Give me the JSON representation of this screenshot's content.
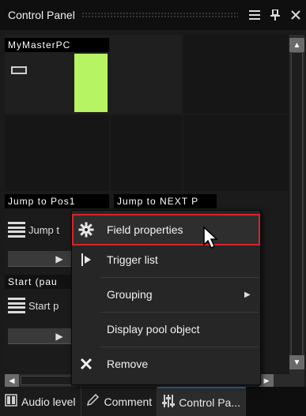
{
  "window": {
    "title": "Control Panel",
    "menu_icon": "hamburger-icon",
    "pin_icon": "pin-icon",
    "close_icon": "close-icon"
  },
  "grid": {
    "master_label": "MyMasterPC",
    "executors": [
      {
        "label": "Jump to Pos1",
        "row_text": "Jump t",
        "play_symbol": "▶"
      },
      {
        "label": "Jump to NEXT P"
      },
      {
        "label": "Start  (pau",
        "row_text": "Start p",
        "play_symbol": "▶"
      }
    ]
  },
  "context_menu": {
    "items": [
      {
        "label": "Field properties",
        "icon": "gear-icon",
        "highlighted": true
      },
      {
        "label": "Trigger list",
        "icon": "trigger-icon"
      },
      {
        "label": "Grouping",
        "icon": "",
        "submenu": "▶"
      },
      {
        "label": "Display pool object",
        "icon": ""
      },
      {
        "label": "Remove",
        "icon": "close-icon"
      }
    ]
  },
  "scroll": {
    "up": "▲",
    "down": "▼",
    "left": "◀",
    "right": "▶"
  },
  "tabs": [
    {
      "label": "Audio level",
      "icon": "audio-level-icon"
    },
    {
      "label": "Comment",
      "icon": "pencil-icon"
    },
    {
      "label": "Control Pa...",
      "icon": "sliders-icon",
      "active": true
    }
  ],
  "colors": {
    "level_bar": "#b6f463",
    "highlight_border": "#d8232a"
  }
}
